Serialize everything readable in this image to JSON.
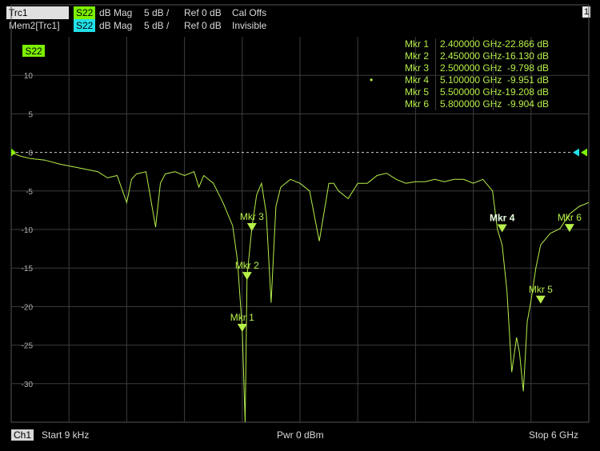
{
  "header": {
    "row1": {
      "trace": "Trc1",
      "param": "S22",
      "format": "dB Mag",
      "scale": "5 dB /",
      "ref": "Ref 0 dB",
      "status": "Cal Offs"
    },
    "row2": {
      "trace": "Mem2[Trc1]",
      "param": "S22",
      "format": "dB Mag",
      "scale": "5 dB /",
      "ref": "Ref 0 dB",
      "status": "Invisible"
    },
    "channel_number": "1"
  },
  "colors": {
    "trace": "#b6ef4a",
    "memory": "#22e0e8",
    "grid": "#3c3c3c",
    "background": "#000000",
    "ref_marker": "#22e0e8"
  },
  "plot_tag": "S22",
  "y_ticks": [
    "10",
    "5",
    "0",
    "-5",
    "-10",
    "-15",
    "-20",
    "-25",
    "-30"
  ],
  "markers": [
    {
      "name": "Mkr 1",
      "freq": "2.400000 GHz",
      "value": "-22.866 dB",
      "active": false
    },
    {
      "name": "Mkr 2",
      "freq": "2.450000 GHz",
      "value": "-16.130 dB",
      "active": false
    },
    {
      "name": "Mkr 3",
      "freq": "2.500000 GHz",
      "value": "-9.798 dB",
      "active": false
    },
    {
      "name": "Mkr 4",
      "freq": "5.100000 GHz",
      "value": "-9.951 dB",
      "active": true
    },
    {
      "name": "Mkr 5",
      "freq": "5.500000 GHz",
      "value": "-19.208 dB",
      "active": false
    },
    {
      "name": "Mkr 6",
      "freq": "5.800000 GHz",
      "value": "-9.904 dB",
      "active": false
    }
  ],
  "footer": {
    "channel": "Ch1",
    "start": "Start  9 kHz",
    "power": "Pwr  0 dBm",
    "stop": "Stop  6 GHz"
  },
  "chart_data": {
    "type": "line",
    "xlim": [
      9e-06,
      6
    ],
    "ylim": [
      -35,
      15
    ],
    "grid": true,
    "series": [
      {
        "name": "S22",
        "x": [
          9e-06,
          0.1,
          0.2,
          0.35,
          0.5,
          0.7,
          0.9,
          1.0,
          1.1,
          1.2,
          1.25,
          1.3,
          1.4,
          1.5,
          1.55,
          1.6,
          1.7,
          1.8,
          1.9,
          1.95,
          2.0,
          2.1,
          2.2,
          2.3,
          2.35,
          2.4,
          2.43,
          2.45,
          2.5,
          2.55,
          2.6,
          2.65,
          2.7,
          2.75,
          2.8,
          2.9,
          3.0,
          3.1,
          3.2,
          3.3,
          3.35,
          3.4,
          3.5,
          3.6,
          3.7,
          3.8,
          3.9,
          4.0,
          4.1,
          4.2,
          4.3,
          4.4,
          4.5,
          4.6,
          4.7,
          4.8,
          4.9,
          5.0,
          5.05,
          5.1,
          5.15,
          5.2,
          5.25,
          5.28,
          5.32,
          5.36,
          5.4,
          5.45,
          5.5,
          5.6,
          5.7,
          5.8,
          5.9,
          6.0
        ],
        "y": [
          0,
          -0.5,
          -0.8,
          -1,
          -1.5,
          -2,
          -2.5,
          -3.3,
          -3,
          -6.5,
          -3.5,
          -2.8,
          -2.5,
          -9.7,
          -4,
          -2.8,
          -2.5,
          -3,
          -2.5,
          -4.5,
          -3,
          -4,
          -6.5,
          -9.5,
          -14,
          -22.9,
          -37,
          -16.1,
          -9.8,
          -5.5,
          -4,
          -8,
          -19.5,
          -7,
          -4.5,
          -3.5,
          -4,
          -5,
          -11.5,
          -4,
          -4,
          -5,
          -6,
          -4,
          -4,
          -3,
          -2.7,
          -3.5,
          -4,
          -3.8,
          -3.8,
          -3.5,
          -3.8,
          -3.5,
          -3.5,
          -4,
          -3.5,
          -5,
          -9.95,
          -12,
          -18,
          -28.5,
          -24,
          -26,
          -31,
          -22,
          -19.2,
          -15,
          -12,
          -10.5,
          -9.9,
          -8,
          -7,
          -6.5
        ]
      }
    ]
  }
}
